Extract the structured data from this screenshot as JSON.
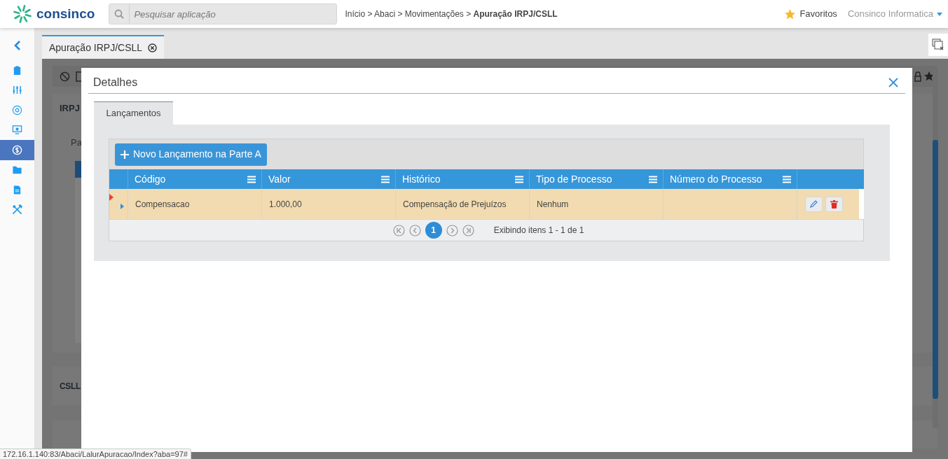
{
  "header": {
    "logo": "consinco",
    "search": {
      "placeholder": "Pesquisar aplicação"
    },
    "breadcrumb": "Início > Abaci > Movimentações > **Apuração IRPJ/CSLL**",
    "favorites": "Favoritos",
    "user": "Consinco Informatica"
  },
  "sidebar": {
    "items": [
      {
        "selected": false
      },
      {
        "selected": false
      },
      {
        "selected": false
      },
      {
        "selected": false
      },
      {
        "selected": true
      },
      {
        "selected": false
      },
      {
        "selected": false
      },
      {
        "selected": false
      }
    ]
  },
  "tabs": [
    {
      "label": "Apuração IRPJ/CSLL",
      "selected": true
    }
  ],
  "background": {
    "labels": [
      "IRPJ",
      "Pa",
      "CSLL"
    ]
  },
  "dialog": {
    "title": "Detalhes",
    "tabs": [
      {
        "label": "Lançamentos",
        "selected": true
      }
    ],
    "add_button": "Novo Lançamento na Parte A",
    "table": {
      "columns": [
        "Código",
        "Valor",
        "Histórico",
        "Tipo de Processo",
        "Número do Processo"
      ],
      "rows": [
        {
          "cells": [
            "Compensacao",
            "1.000,00",
            "Compensação de Prejuízos",
            "Nenhum",
            ""
          ],
          "selected": true
        }
      ]
    },
    "pager": {
      "pages": [
        {
          "label": "1",
          "selected": true
        }
      ],
      "summary": "Exibindo itens 1 - 1 de 1"
    }
  },
  "status_bar": "172.16.1.140:83/Abaci/LalurApuracao/Index?aba=97#"
}
